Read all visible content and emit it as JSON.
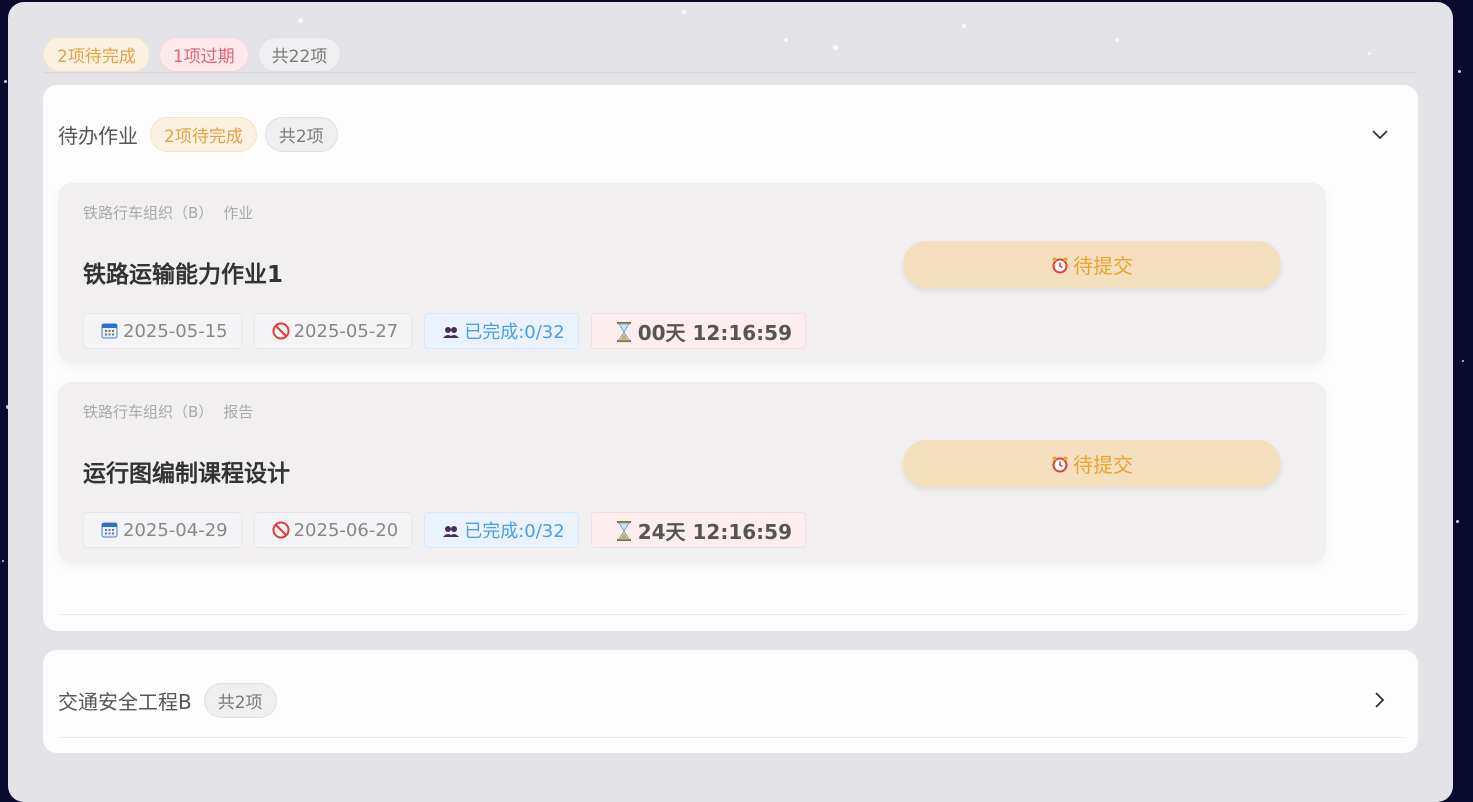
{
  "summary_badges": {
    "pending": "2项待完成",
    "overdue": "1项过期",
    "total": "共22项"
  },
  "sections": [
    {
      "title": "待办作业",
      "pending_badge": "2项待完成",
      "count_badge": "共2项",
      "expanded": true,
      "items": [
        {
          "course": "铁路行车组织（B）",
          "type": "作业",
          "title": "铁路运输能力作业1",
          "status": "待提交",
          "start_date": "2025-05-15",
          "due_date": "2025-05-27",
          "completed": "已完成:0/32",
          "countdown": "00天 12:16:59"
        },
        {
          "course": "铁路行车组织（B）",
          "type": "报告",
          "title": "运行图编制课程设计",
          "status": "待提交",
          "start_date": "2025-04-29",
          "due_date": "2025-06-20",
          "completed": "已完成:0/32",
          "countdown": "24天 12:16:59"
        }
      ]
    },
    {
      "title": "交通安全工程B",
      "count_badge": "共2项",
      "expanded": false
    }
  ],
  "colors": {
    "pending": "#e3a23c",
    "overdue": "#e06570",
    "status_button_bg": "#f4dfbe",
    "completed_text": "#4a9de6"
  },
  "icons": {
    "start_date": "calendar-icon",
    "due_date": "prohibited-icon",
    "completed": "people-icon",
    "countdown": "hourglass-icon",
    "status": "alarm-clock-icon"
  }
}
